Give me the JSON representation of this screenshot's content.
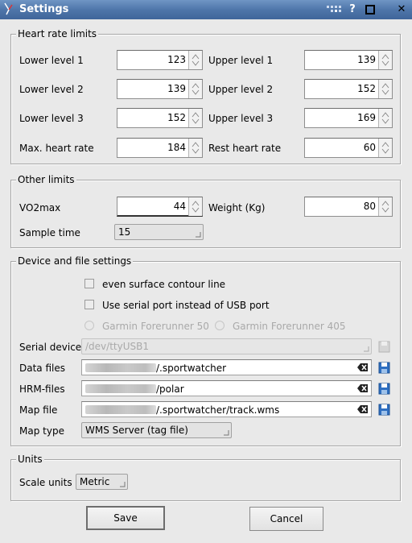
{
  "window": {
    "title": "Settings",
    "buttons": {
      "help": "?",
      "maximize": "□",
      "close": "✕"
    }
  },
  "heart_rate": {
    "title": "Heart rate limits",
    "lower1": {
      "label": "Lower level 1",
      "value": "123"
    },
    "upper1": {
      "label": "Upper level 1",
      "value": "139"
    },
    "lower2": {
      "label": "Lower level 2",
      "value": "139"
    },
    "upper2": {
      "label": "Upper level 2",
      "value": "152"
    },
    "lower3": {
      "label": "Lower level 3",
      "value": "152"
    },
    "upper3": {
      "label": "Upper level 3",
      "value": "169"
    },
    "max": {
      "label": "Max. heart rate",
      "value": "184"
    },
    "rest": {
      "label": "Rest heart rate",
      "value": "60"
    }
  },
  "other": {
    "title": "Other limits",
    "vo2max": {
      "label": "VO2max",
      "value": "44"
    },
    "weight": {
      "label": "Weight (Kg)",
      "value": "80"
    },
    "sample": {
      "label": "Sample time",
      "value": "15"
    }
  },
  "device": {
    "title": "Device and file settings",
    "even_surface": {
      "label": "even surface contour line",
      "checked": false
    },
    "serial_port": {
      "label": "Use serial port instead of USB port",
      "checked": false
    },
    "radio1": "Garmin Forerunner 50",
    "radio2": "Garmin Forerunner 405",
    "serial_device": {
      "label": "Serial device",
      "value": "/dev/ttyUSB1"
    },
    "data_files": {
      "label": "Data files",
      "value": "/.sportwatcher"
    },
    "hrm_files": {
      "label": "HRM-files",
      "value": "/polar"
    },
    "map_file": {
      "label": "Map file",
      "value": "/.sportwatcher/track.wms"
    },
    "map_type": {
      "label": "Map type",
      "value": "WMS Server (tag file)"
    }
  },
  "units": {
    "title": "Units",
    "scale": {
      "label": "Scale units",
      "value": "Metric"
    }
  },
  "actions": {
    "save": "Save",
    "cancel": "Cancel"
  },
  "colors": {
    "titlebar": "#4f76aa",
    "save_icon": "#2f6fc1"
  }
}
